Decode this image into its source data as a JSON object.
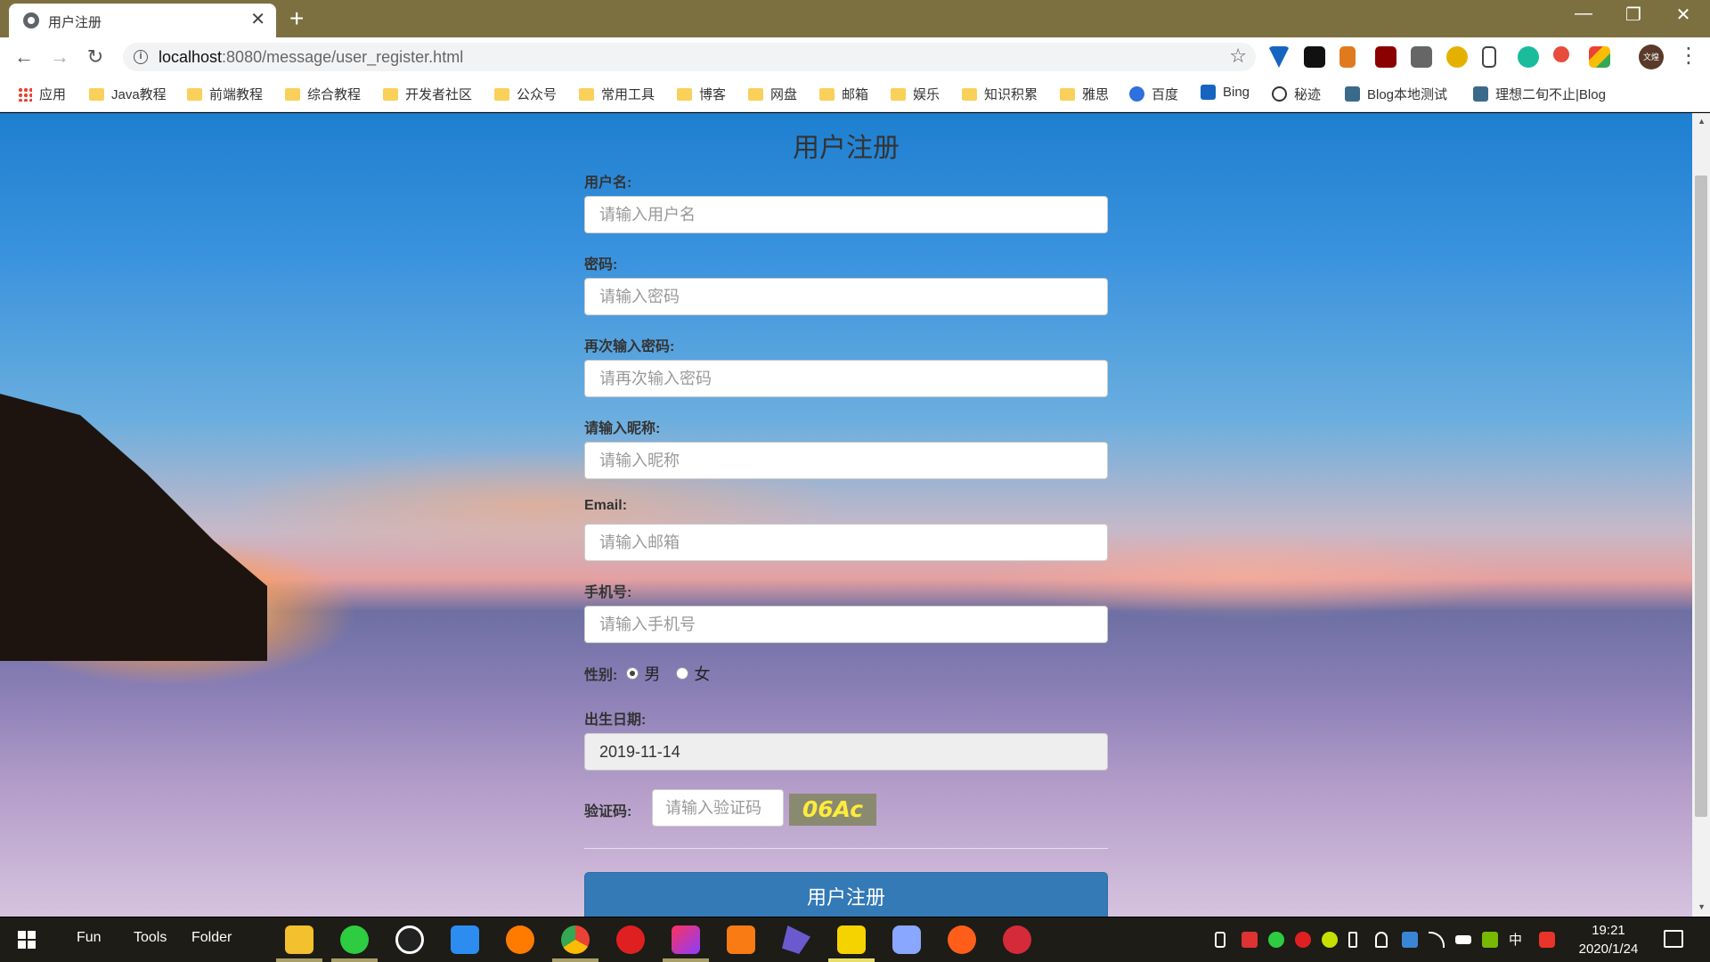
{
  "browser": {
    "tab_title": "用户注册",
    "tab_close": "✕",
    "new_tab": "+",
    "url_host": "localhost",
    "url_path": ":8080/message/user_register.html",
    "avatar_text": "文煌",
    "bookmarks": [
      {
        "label": "应用",
        "icon": "apps-icon"
      },
      {
        "label": "Java教程",
        "icon": "folder-icon"
      },
      {
        "label": "前端教程",
        "icon": "folder-icon"
      },
      {
        "label": "综合教程",
        "icon": "folder-icon"
      },
      {
        "label": "开发者社区",
        "icon": "folder-icon"
      },
      {
        "label": "公众号",
        "icon": "folder-icon"
      },
      {
        "label": "常用工具",
        "icon": "folder-icon"
      },
      {
        "label": "博客",
        "icon": "folder-icon"
      },
      {
        "label": "网盘",
        "icon": "folder-icon"
      },
      {
        "label": "邮箱",
        "icon": "folder-icon"
      },
      {
        "label": "娱乐",
        "icon": "folder-icon"
      },
      {
        "label": "知识积累",
        "icon": "folder-icon"
      },
      {
        "label": "雅思",
        "icon": "folder-icon"
      },
      {
        "label": "百度",
        "icon": "baidu-icon"
      },
      {
        "label": "Bing",
        "icon": "bing-icon"
      },
      {
        "label": "秘迹",
        "icon": "miji-icon"
      },
      {
        "label": "Blog本地测试",
        "icon": "blog-icon"
      },
      {
        "label": "理想二旬不止|Blog",
        "icon": "blog-icon"
      }
    ]
  },
  "form": {
    "title": "用户注册",
    "username_label": "用户名:",
    "username_placeholder": "请输入用户名",
    "password_label": "密码:",
    "password_placeholder": "请输入密码",
    "password2_label": "再次输入密码:",
    "password2_placeholder": "请再次输入密码",
    "nickname_label": "请输入昵称:",
    "nickname_placeholder": "请输入昵称",
    "email_label": "Email:",
    "email_placeholder": "请输入邮箱",
    "phone_label": "手机号:",
    "phone_placeholder": "请输入手机号",
    "gender_label": "性别:",
    "gender_male": "男",
    "gender_female": "女",
    "gender_selected": "男",
    "birthday_label": "出生日期:",
    "birthday_value": "2019-11-14",
    "captcha_label": "验证码:",
    "captcha_placeholder": "请输入验证码",
    "captcha_code": "06Ac",
    "submit_label": "用户注册"
  },
  "taskbar": {
    "items": [
      "Fun",
      "Tools",
      "Folder"
    ],
    "time": "19:21",
    "date": "2020/1/24",
    "ime": "中"
  },
  "colors": {
    "title_bar": "#7d7040",
    "submit_button": "#337ab7",
    "captcha_text": "#ffeb3b"
  }
}
